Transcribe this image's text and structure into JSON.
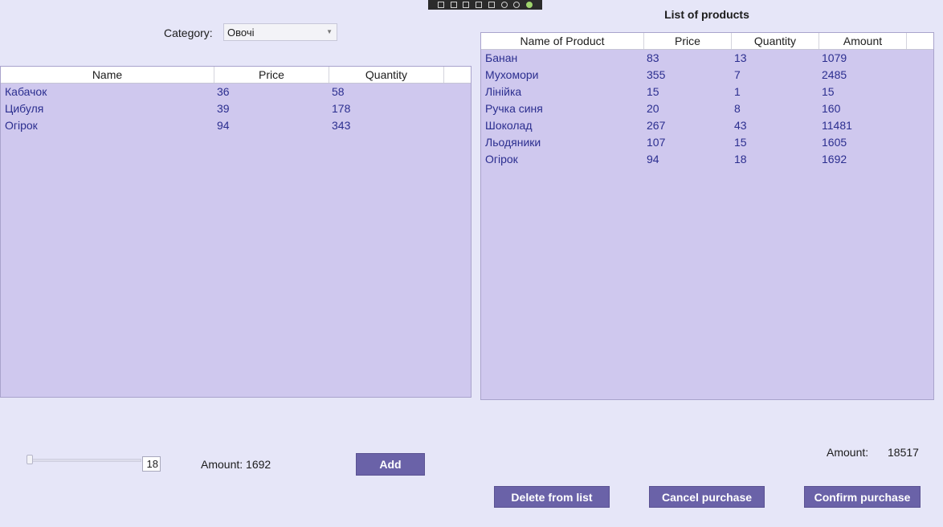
{
  "category": {
    "label": "Category:",
    "selected": "Овочі"
  },
  "products_title": "List of products",
  "left_table": {
    "columns": [
      "Name",
      "Price",
      "Quantity"
    ],
    "rows": [
      [
        "Кабачок",
        "36",
        "58"
      ],
      [
        "Цибуля",
        "39",
        "178"
      ],
      [
        "Огірок",
        "94",
        "343"
      ]
    ]
  },
  "right_table": {
    "columns": [
      "Name of Product",
      "Price",
      "Quantity",
      "Amount"
    ],
    "rows": [
      [
        "Банан",
        "83",
        "13",
        "1079"
      ],
      [
        "Мухомори",
        "355",
        "7",
        "2485"
      ],
      [
        "Лінійка",
        "15",
        "1",
        "15"
      ],
      [
        "Ручка синя",
        "20",
        "8",
        "160"
      ],
      [
        "Шоколад",
        "267",
        "43",
        "11481"
      ],
      [
        "Льодяники",
        "107",
        "15",
        "1605"
      ],
      [
        "Огірок",
        "94",
        "18",
        "1692"
      ]
    ]
  },
  "quantity_slider": {
    "value": "18"
  },
  "amount_left": "Amount: 1692",
  "amount_total": {
    "label": "Amount:",
    "value": "18517"
  },
  "buttons": {
    "add": "Add",
    "delete": "Delete from list",
    "cancel": "Cancel purchase",
    "confirm": "Confirm purchase"
  },
  "colors": {
    "background": "#e6e6f8",
    "grid_fill": "#cfc8ee",
    "button": "#6a62a8",
    "row_text": "#2b2e8f"
  }
}
